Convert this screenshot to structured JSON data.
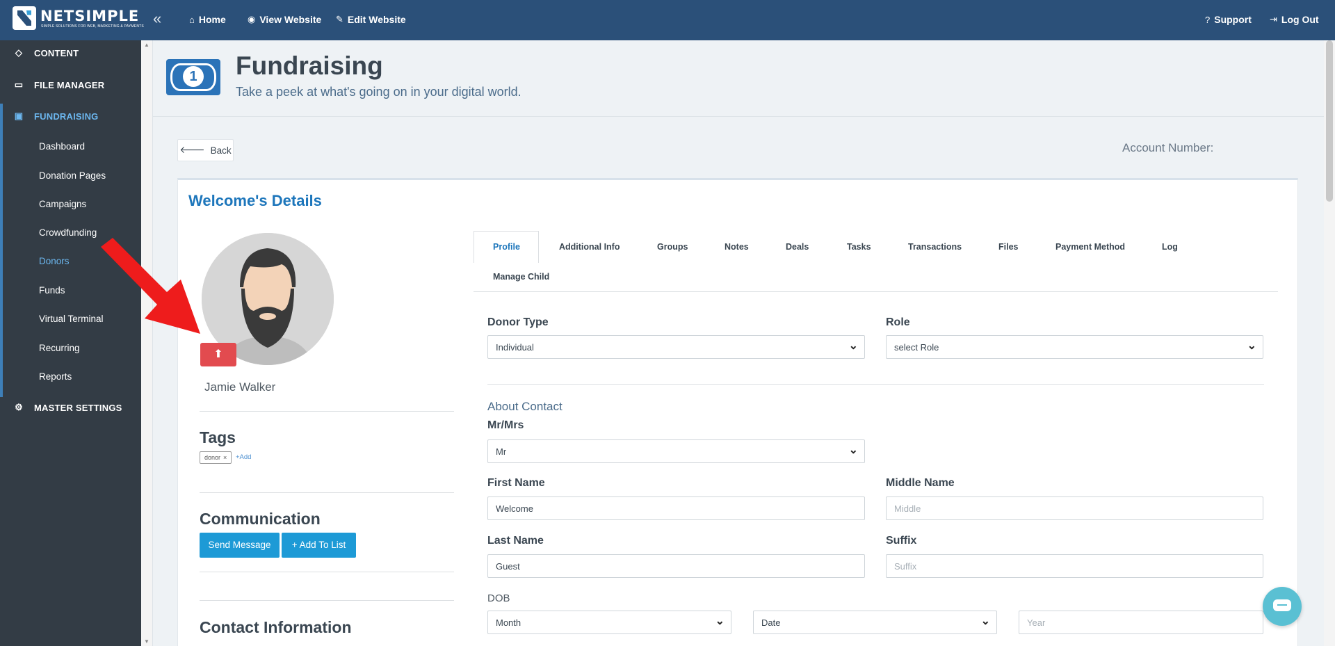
{
  "topbar": {
    "logo_text": "NETSIMPLE",
    "logo_tagline": "SIMPLE SOLUTIONS FOR WEB, MARKETING & PAYMENTS",
    "nav": [
      {
        "label": "Home",
        "icon": "home-icon"
      },
      {
        "label": "View Website",
        "icon": "eye-icon"
      },
      {
        "label": "Edit Website",
        "icon": "edit-icon"
      }
    ],
    "support_label": "Support",
    "logout_label": "Log Out"
  },
  "sidebar": {
    "items": [
      {
        "label": "CONTENT",
        "icon": "diamond-icon"
      },
      {
        "label": "FILE MANAGER",
        "icon": "folder-icon"
      },
      {
        "label": "FUNDRAISING",
        "icon": "money-icon"
      },
      {
        "label": "MASTER SETTINGS",
        "icon": "gear-icon"
      }
    ],
    "sub_items": [
      "Dashboard",
      "Donation Pages",
      "Campaigns",
      "Crowdfunding",
      "Donors",
      "Funds",
      "Virtual Terminal",
      "Recurring",
      "Reports"
    ],
    "active_sub": "Donors"
  },
  "page": {
    "title": "Fundraising",
    "subtitle": "Take a peek at what's going on in your digital world.",
    "back_label": "Back",
    "account_label": "Account Number:"
  },
  "card": {
    "title": "Welcome's Details",
    "person_name": "Jamie Walker",
    "tags_title": "Tags",
    "tag": "donor",
    "tag_add": "+Add",
    "communication_title": "Communication",
    "send_message_label": "Send Message",
    "add_to_list_label": "+ Add To List",
    "contact_info_title": "Contact Information"
  },
  "tabs": [
    "Profile",
    "Additional Info",
    "Groups",
    "Notes",
    "Deals",
    "Tasks",
    "Transactions",
    "Files",
    "Payment Method",
    "Log",
    "Manage Child"
  ],
  "active_tab": "Profile",
  "form": {
    "donor_type_label": "Donor Type",
    "donor_type_value": "Individual",
    "role_label": "Role",
    "role_value": "select Role",
    "about_label": "About Contact",
    "salutation_label": "Mr/Mrs",
    "salutation_value": "Mr",
    "first_name_label": "First Name",
    "first_name_value": "Welcome",
    "middle_name_label": "Middle Name",
    "middle_name_placeholder": "Middle",
    "last_name_label": "Last Name",
    "last_name_value": "Guest",
    "suffix_label": "Suffix",
    "suffix_placeholder": "Suffix",
    "dob_label": "DOB",
    "month_value": "Month",
    "date_value": "Date",
    "year_placeholder": "Year"
  },
  "colors": {
    "topbar": "#2b5079",
    "sidebar": "#333c45",
    "accent": "#1d76bb",
    "upload": "#e24b4f",
    "button": "#1d9ad6",
    "arrow": "#ee1c1c"
  }
}
